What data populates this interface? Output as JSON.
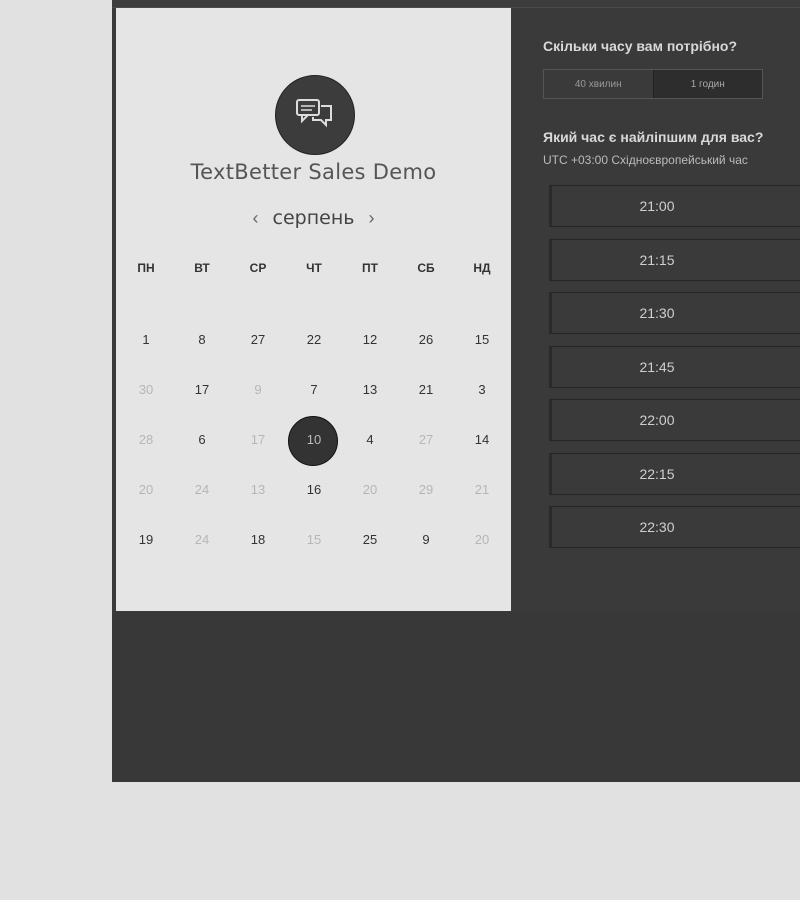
{
  "product": {
    "title": "TextBetter Sales Demo",
    "icon": "chat-bubbles-icon"
  },
  "calendar": {
    "month": "серпень",
    "prev_icon": "‹",
    "next_icon": "›",
    "weekdays": [
      "ПН",
      "ВТ",
      "СР",
      "ЧТ",
      "ПТ",
      "СБ",
      "НД"
    ],
    "weeks": [
      [
        "1",
        "8",
        "27",
        "22",
        "12",
        "26",
        "15"
      ],
      [
        "30",
        "17",
        "9",
        "7",
        "13",
        "21",
        "3"
      ],
      [
        "28",
        "6",
        "17",
        "10",
        "4",
        "27",
        "14"
      ],
      [
        "20",
        "24",
        "13",
        "16",
        "20",
        "29",
        "21"
      ],
      [
        "19",
        "24",
        "18",
        "15",
        "25",
        "9",
        "20"
      ]
    ],
    "selected": "10"
  },
  "duration": {
    "question": "Скільки часу вам потрібно?",
    "options": [
      "40 хвилин",
      "1 годин"
    ],
    "selected": "1 годин"
  },
  "time": {
    "question": "Який час є найліпшим для вас?",
    "timezone": "UTC +03:00 Східноєвропейський час",
    "slots": [
      "21:00",
      "21:15",
      "21:30",
      "21:45",
      "22:00",
      "22:15",
      "22:30"
    ]
  },
  "colors": {
    "page_bg": "#e1e1e1",
    "panel_dark": "#3a3a3a",
    "panel_light": "#e5e5e5"
  }
}
